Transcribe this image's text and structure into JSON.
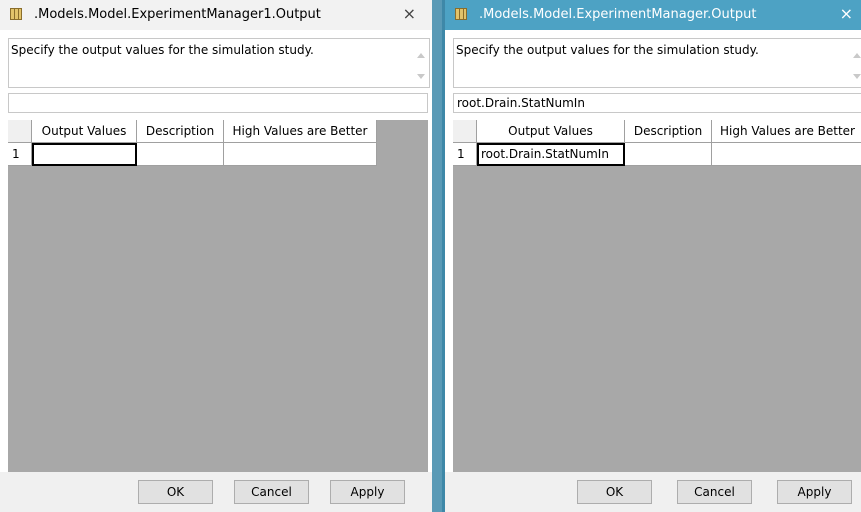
{
  "left_dialog": {
    "title": ".Models.Model.ExperimentManager1.Output",
    "close_glyph": "×",
    "description": "Specify the output values for the simulation study.",
    "variable_value": "",
    "grid": {
      "headers": [
        "Output Values",
        "Description",
        "High Values are Better"
      ],
      "rows": [
        {
          "index": "1",
          "cells": [
            "",
            "",
            ""
          ]
        }
      ]
    },
    "buttons": {
      "ok": "OK",
      "cancel": "Cancel",
      "apply": "Apply"
    }
  },
  "right_dialog": {
    "title": ".Models.Model.ExperimentManager.Output",
    "close_glyph": "×",
    "description": "Specify the output values for the simulation study.",
    "variable_value": "root.Drain.StatNumIn",
    "grid": {
      "headers": [
        "Output Values",
        "Description",
        "High Values are Better"
      ],
      "rows": [
        {
          "index": "1",
          "cells": [
            "root.Drain.StatNumIn",
            "",
            ""
          ]
        }
      ]
    },
    "buttons": {
      "ok": "OK",
      "cancel": "Cancel",
      "apply": "Apply"
    }
  },
  "colors": {
    "active_titlebar": "#4da2c4",
    "inactive_titlebar": "#f2f2f2",
    "grid_background": "#a8a8a8",
    "separator": "#5a9ab6"
  },
  "icons": {
    "window_icon": "table-icon",
    "close": "close-icon"
  }
}
